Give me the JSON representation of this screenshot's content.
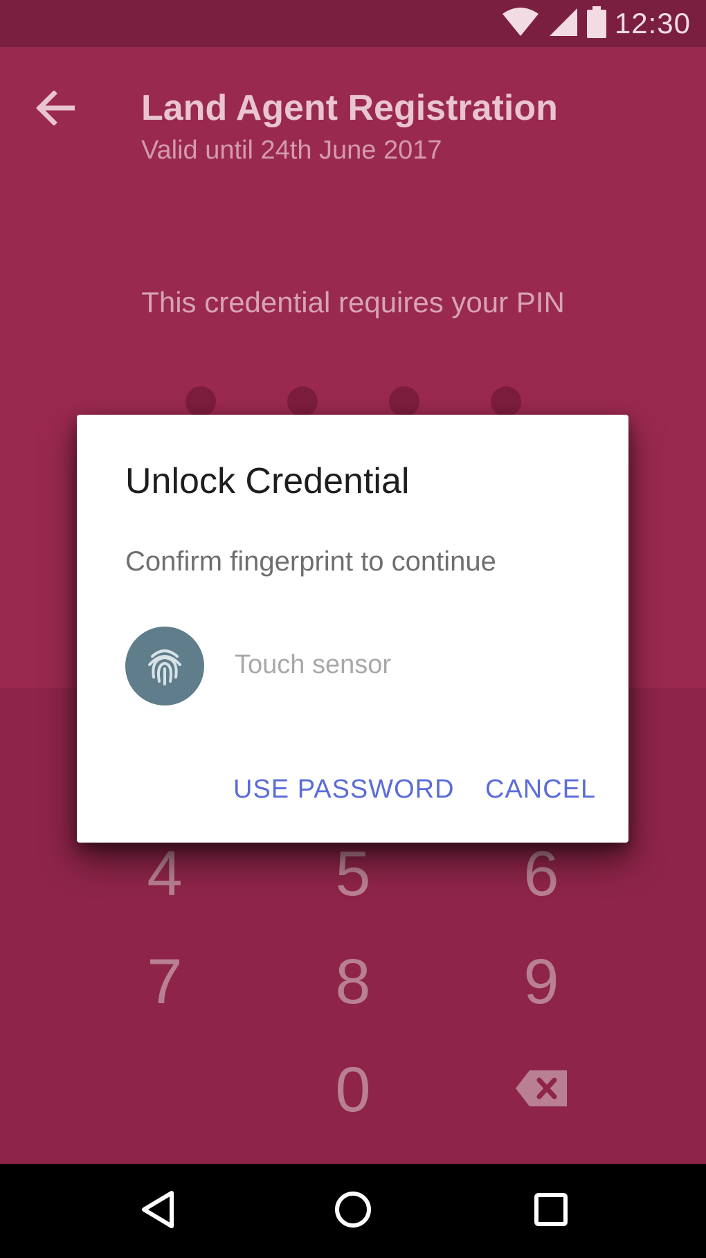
{
  "status_bar": {
    "time": "12:30",
    "icons": [
      "wifi-icon",
      "signal-icon",
      "battery-icon"
    ]
  },
  "header": {
    "title": "Land Agent Registration",
    "subtitle": "Valid until 24th June 2017",
    "back_icon": "arrow-left-icon"
  },
  "pin_screen": {
    "prompt": "This credential requires your PIN",
    "dot_count": 4,
    "keypad": {
      "key_4": "4",
      "key_5": "5",
      "key_6": "6",
      "key_7": "7",
      "key_8": "8",
      "key_9": "9",
      "key_0": "0"
    },
    "backspace_icon": "backspace-icon"
  },
  "dialog": {
    "title": "Unlock Credential",
    "message": "Confirm fingerprint to continue",
    "sensor_label": "Touch sensor",
    "fingerprint_icon": "fingerprint-icon",
    "use_password_label": "USE PASSWORD",
    "cancel_label": "CANCEL"
  },
  "nav_bar": {
    "icons": [
      "back-triangle-icon",
      "home-circle-icon",
      "recents-square-icon"
    ]
  },
  "colors": {
    "status_bar": "#7a1f3f",
    "app_background": "#9a294f",
    "keypad_background": "#8e2449",
    "dialog_accent": "#5a6cd8",
    "fingerprint_circle": "#5f7d8a"
  }
}
